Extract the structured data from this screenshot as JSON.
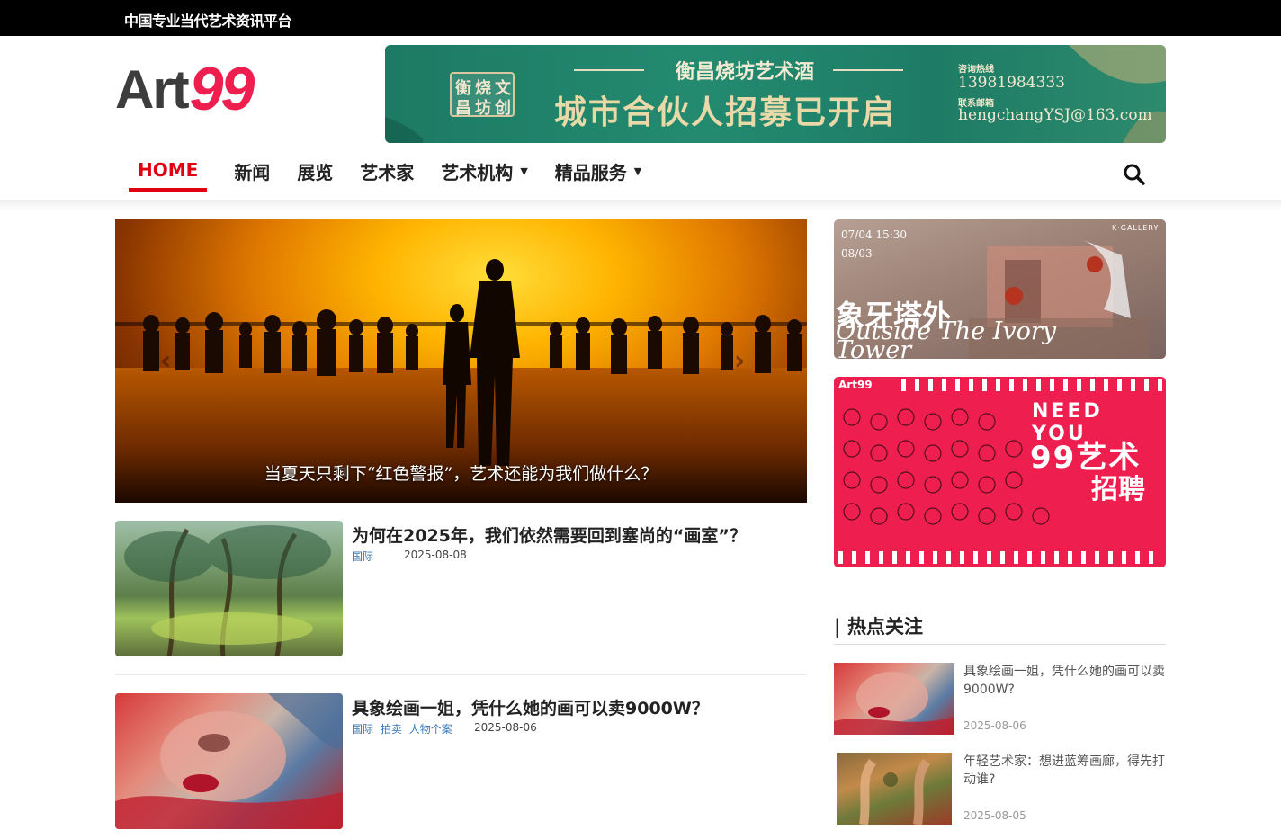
{
  "topbar": {
    "tagline": "中国专业当代艺术资讯平台"
  },
  "logo": {
    "text1": "Art",
    "text2": "99"
  },
  "banner": {
    "mark_chars": [
      "衡",
      "烧",
      "文",
      "昌",
      "坊",
      "创"
    ],
    "subtitle": "衡昌烧坊艺术酒",
    "headline": "城市合伙人招募已开启",
    "contact_label1": "咨询热线",
    "phone": "13981984333",
    "contact_label2": "联系邮箱",
    "email": "hengchangYSJ@163.com"
  },
  "nav": {
    "items": [
      {
        "label": "HOME",
        "active": true
      },
      {
        "label": "新闻"
      },
      {
        "label": "展览"
      },
      {
        "label": "艺术家"
      },
      {
        "label": "艺术机构",
        "dropdown": true
      },
      {
        "label": "精品服务",
        "dropdown": true
      }
    ]
  },
  "slider": {
    "caption": "当夏天只剩下“红色警报”，艺术还能为我们做什么？"
  },
  "posts": [
    {
      "title": "为何在2025年，我们依然需要回到塞尚的“画室”？",
      "categories": [
        "国际"
      ],
      "date": "2025-08-08"
    },
    {
      "title": "具象绘画一姐，凭什么她的画可以卖9000W？",
      "categories": [
        "国际",
        "拍卖",
        "人物个案"
      ],
      "date": "2025-08-06"
    }
  ],
  "side_ad1": {
    "date1": "07/04",
    "time": "15:30",
    "date2": "08/03",
    "gallery": "K·GALLERY",
    "title_cn": "象牙塔外",
    "title_en1": "Outside The Ivory",
    "title_en2": "Tower"
  },
  "side_ad2": {
    "brand": "Art99",
    "need": "NEED YOU",
    "line1": "99艺术",
    "line2": "招聘"
  },
  "hot": {
    "heading": "| 热点关注",
    "items": [
      {
        "title": "具象绘画一姐，凭什么她的画可以卖9000W?",
        "date": "2025-08-06"
      },
      {
        "title": "年轻艺术家：想进蓝筹画廊，得先打动谁?",
        "date": "2025-08-05"
      }
    ]
  }
}
